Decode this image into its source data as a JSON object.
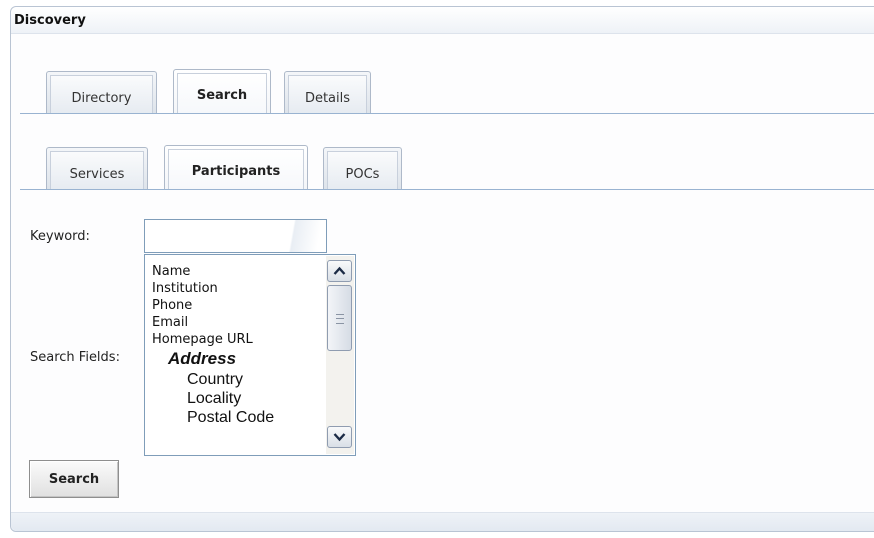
{
  "panel": {
    "title": "Discovery"
  },
  "main_tabs": [
    {
      "label": "Directory",
      "active": false
    },
    {
      "label": "Search",
      "active": true
    },
    {
      "label": "Details",
      "active": false
    }
  ],
  "sub_tabs": [
    {
      "label": "Services",
      "active": false
    },
    {
      "label": "Participants",
      "active": true
    },
    {
      "label": "POCs",
      "active": false
    }
  ],
  "form": {
    "keyword_label": "Keyword:",
    "keyword_value": "",
    "search_fields_label": "Search Fields:",
    "search_fields_options": [
      {
        "label": "Name",
        "kind": "option"
      },
      {
        "label": "Institution",
        "kind": "option"
      },
      {
        "label": "Phone",
        "kind": "option"
      },
      {
        "label": "Email",
        "kind": "option"
      },
      {
        "label": "Homepage URL",
        "kind": "option"
      },
      {
        "label": "Address",
        "kind": "group"
      },
      {
        "label": "Country",
        "kind": "sub"
      },
      {
        "label": "Locality",
        "kind": "sub"
      },
      {
        "label": "Postal Code",
        "kind": "sub"
      }
    ],
    "submit_label": "Search"
  },
  "icons": {
    "scroll_up": "chevron-up-icon",
    "scroll_down": "chevron-down-icon"
  }
}
